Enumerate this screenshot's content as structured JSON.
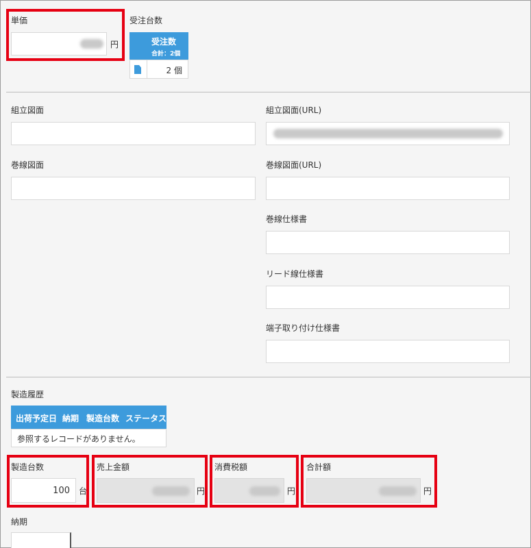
{
  "unit_price": {
    "label": "単価",
    "unit": "円"
  },
  "order_qty": {
    "label": "受注台数",
    "table_header": "受注数",
    "table_total": "合計：2個",
    "row_value": "2 個"
  },
  "drawings": {
    "assembly_drawing": "組立図面",
    "assembly_drawing_url": "組立図面(URL)",
    "winding_drawing": "巻線図面",
    "winding_drawing_url": "巻線図面(URL)",
    "winding_spec": "巻線仕様書",
    "lead_wire_spec": "リード線仕様書",
    "terminal_spec": "端子取り付け仕様書"
  },
  "history": {
    "label": "製造履歴",
    "columns": [
      "出荷予定日",
      "納期",
      "製造台数",
      "ステータス"
    ],
    "empty_text": "参照するレコードがありません。"
  },
  "totals": {
    "mfg_qty": {
      "label": "製造台数",
      "value": "100",
      "unit": "台"
    },
    "sales_amount": {
      "label": "売上金額",
      "unit": "円"
    },
    "tax_amount": {
      "label": "消費税額",
      "unit": "円"
    },
    "total_amount": {
      "label": "合計額",
      "unit": "円"
    }
  },
  "delivery": {
    "label": "納期"
  },
  "colors": {
    "accent": "#3d9bdc",
    "highlight": "#e60012"
  }
}
